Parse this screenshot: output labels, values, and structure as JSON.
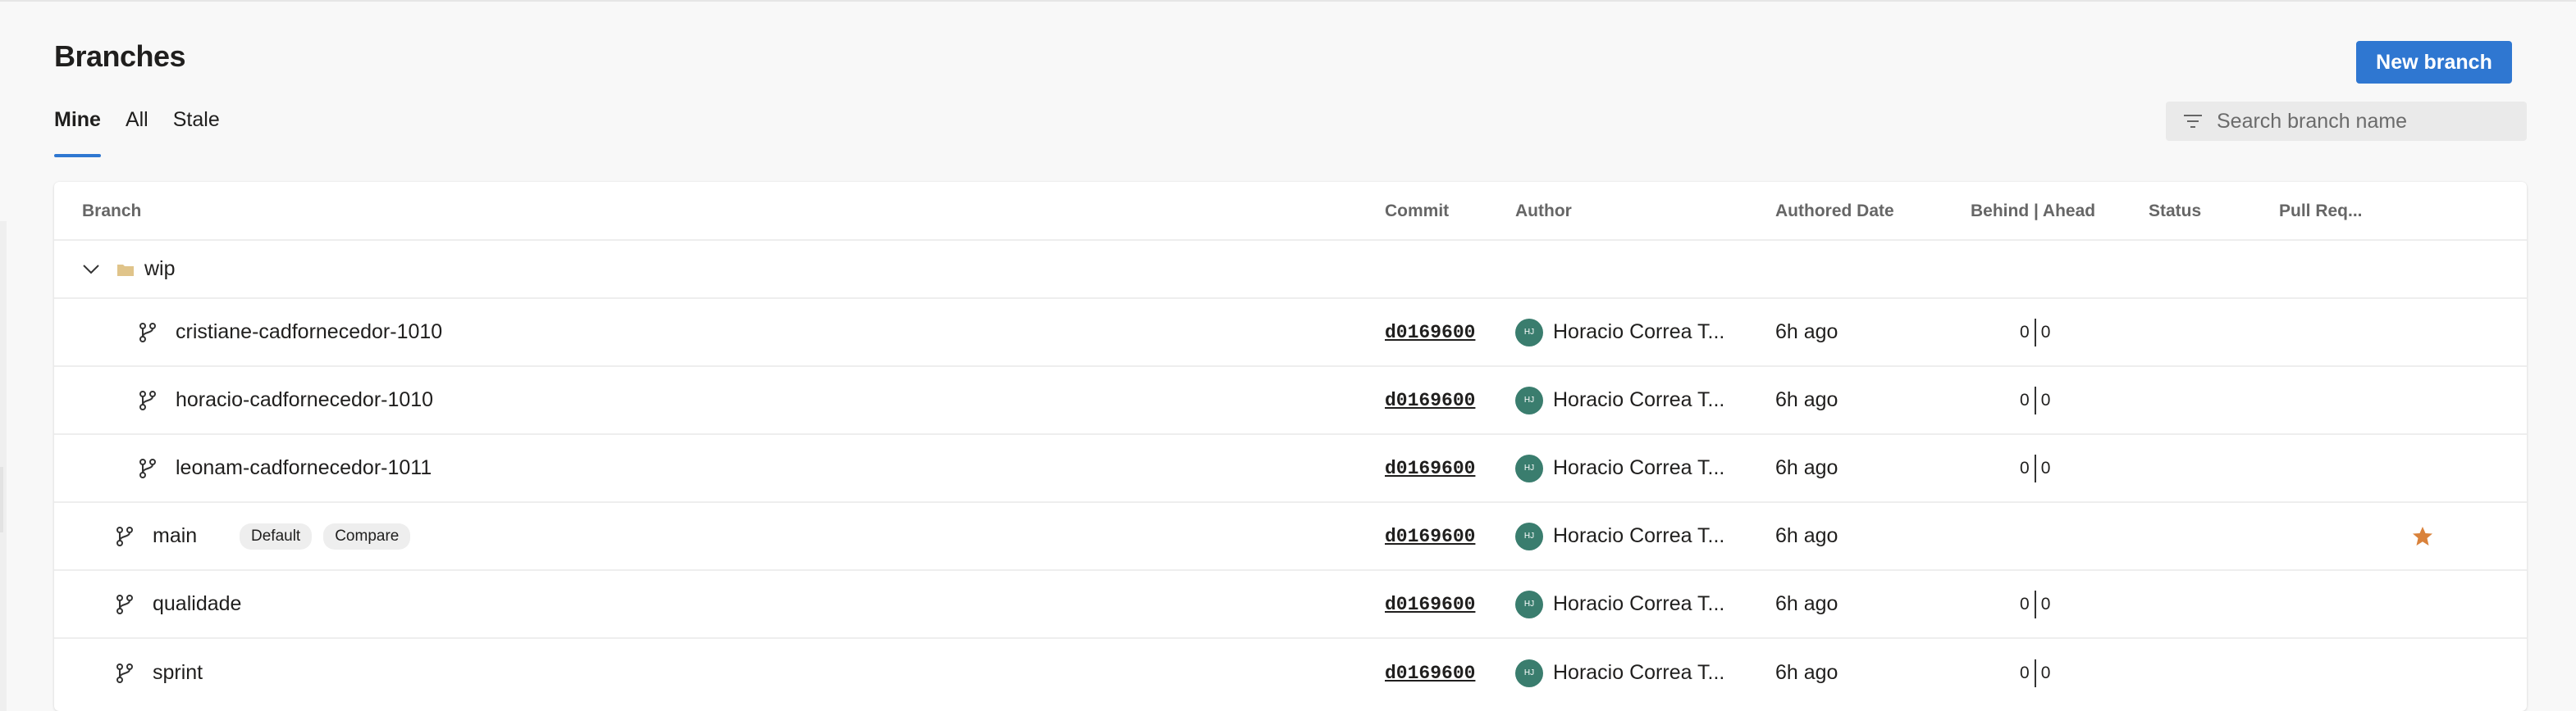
{
  "page": {
    "title": "Branches",
    "new_branch_label": "New branch",
    "search_placeholder": "Search branch name",
    "accent_color": "#2f77d1",
    "tabs": [
      {
        "label": "Mine",
        "active": true
      },
      {
        "label": "All",
        "active": false
      },
      {
        "label": "Stale",
        "active": false
      }
    ]
  },
  "table": {
    "headers": {
      "branch": "Branch",
      "commit": "Commit",
      "author": "Author",
      "date": "Authored Date",
      "behind_ahead": "Behind | Ahead",
      "status": "Status",
      "pull_request": "Pull Req..."
    },
    "folder": {
      "name": "wip",
      "expanded": true
    },
    "rows": [
      {
        "name": "cristiane-cadfornecedor-1010",
        "commit": "d0169600",
        "avatar": "HJ",
        "author": "Horacio Correa T...",
        "date": "6h ago",
        "behind": "0",
        "ahead": "0"
      },
      {
        "name": "horacio-cadfornecedor-1010",
        "commit": "d0169600",
        "avatar": "HJ",
        "author": "Horacio Correa T...",
        "date": "6h ago",
        "behind": "0",
        "ahead": "0"
      },
      {
        "name": "leonam-cadfornecedor-1011",
        "commit": "d0169600",
        "avatar": "HJ",
        "author": "Horacio Correa T...",
        "date": "6h ago",
        "behind": "0",
        "ahead": "0"
      },
      {
        "name": "main",
        "badge_default": "Default",
        "badge_compare": "Compare",
        "commit": "d0169600",
        "avatar": "HJ",
        "author": "Horacio Correa T...",
        "date": "6h ago",
        "favorite": true
      },
      {
        "name": "qualidade",
        "commit": "d0169600",
        "avatar": "HJ",
        "author": "Horacio Correa T...",
        "date": "6h ago",
        "behind": "0",
        "ahead": "0"
      },
      {
        "name": "sprint",
        "commit": "d0169600",
        "avatar": "HJ",
        "author": "Horacio Correa T...",
        "date": "6h ago",
        "behind": "0",
        "ahead": "0"
      }
    ]
  },
  "icons": {
    "filter": "filter-icon",
    "branch": "branch-icon",
    "folder": "folder-icon",
    "chevron": "chevron-down-icon",
    "star": "star-icon"
  },
  "colors": {
    "avatar_bg": "#3a7d6e",
    "star": "#d9823b",
    "folder": "#e0c48a"
  }
}
